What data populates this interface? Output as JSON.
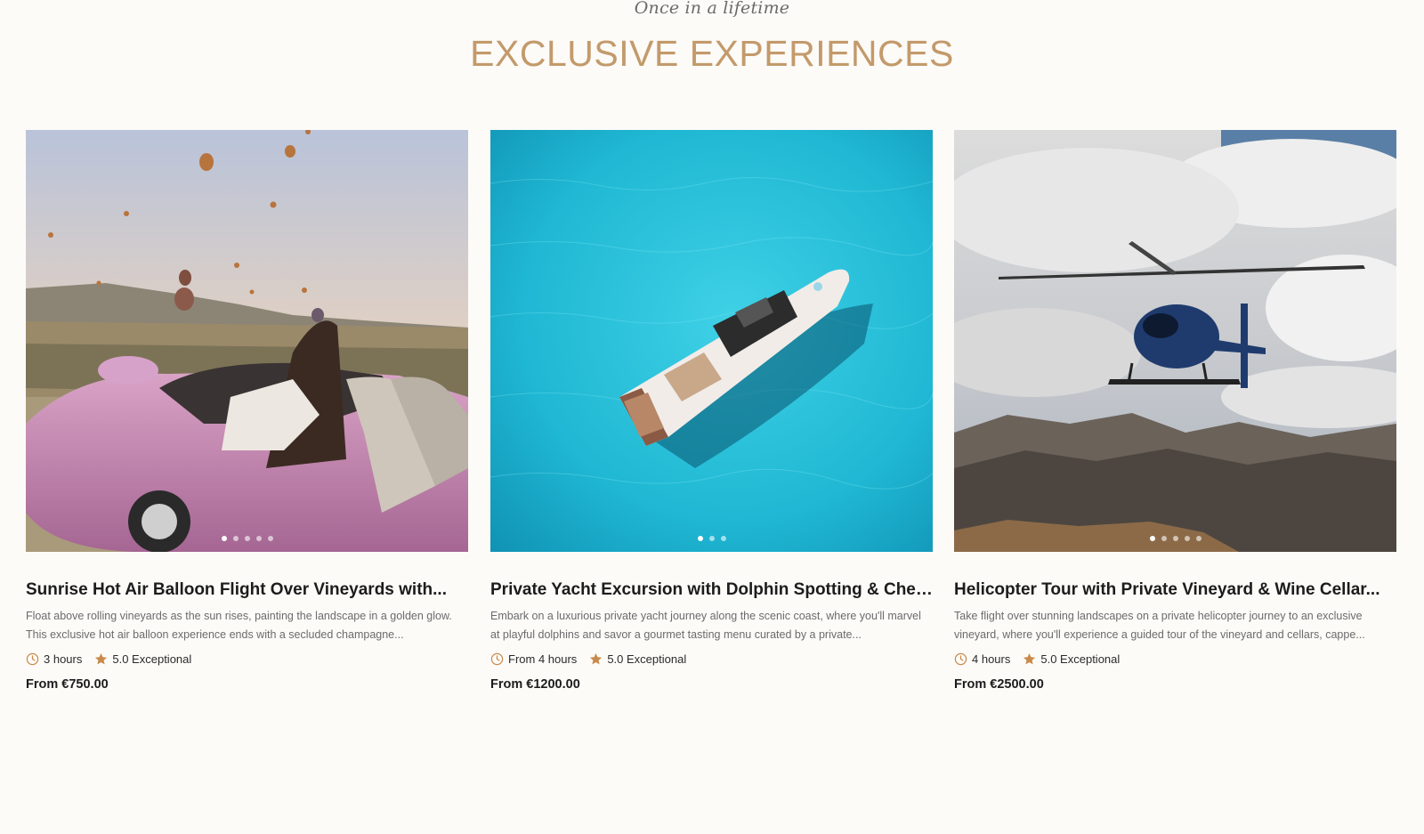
{
  "section": {
    "eyebrow": "Once in a lifetime",
    "title": "EXCLUSIVE EXPERIENCES"
  },
  "colors": {
    "accent": "#c39a6b",
    "star": "#c98a4b",
    "background": "#fcfbf8"
  },
  "experiences": [
    {
      "image_icon": "hot-air-balloon-photo",
      "title": "Sunrise Hot Air Balloon Flight Over Vineyards with...",
      "description": "Float above rolling vineyards as the sun rises, painting the landscape in a golden glow. This exclusive hot air balloon experience ends with a secluded champagne...",
      "duration": "3 hours",
      "rating": "5.0 Exceptional",
      "price": "From €750.00",
      "slide_count": 5,
      "active_slide": 1
    },
    {
      "image_icon": "yacht-photo",
      "title": "Private Yacht Excursion with Dolphin Spotting & Chef’...",
      "description": "Embark on a luxurious private yacht journey along the scenic coast, where you'll marvel at playful dolphins and savor a gourmet tasting menu curated by a private...",
      "duration": "From 4 hours",
      "rating": "5.0 Exceptional",
      "price": "From €1200.00",
      "slide_count": 3,
      "active_slide": 1
    },
    {
      "image_icon": "helicopter-photo",
      "title": "Helicopter Tour with Private Vineyard & Wine Cellar...",
      "description": "Take flight over stunning landscapes on a private helicopter journey to an exclusive vineyard, where you'll experience a guided tour of the vineyard and cellars, cappe...",
      "duration": "4 hours",
      "rating": "5.0 Exceptional",
      "price": "From €2500.00",
      "slide_count": 5,
      "active_slide": 1
    }
  ]
}
